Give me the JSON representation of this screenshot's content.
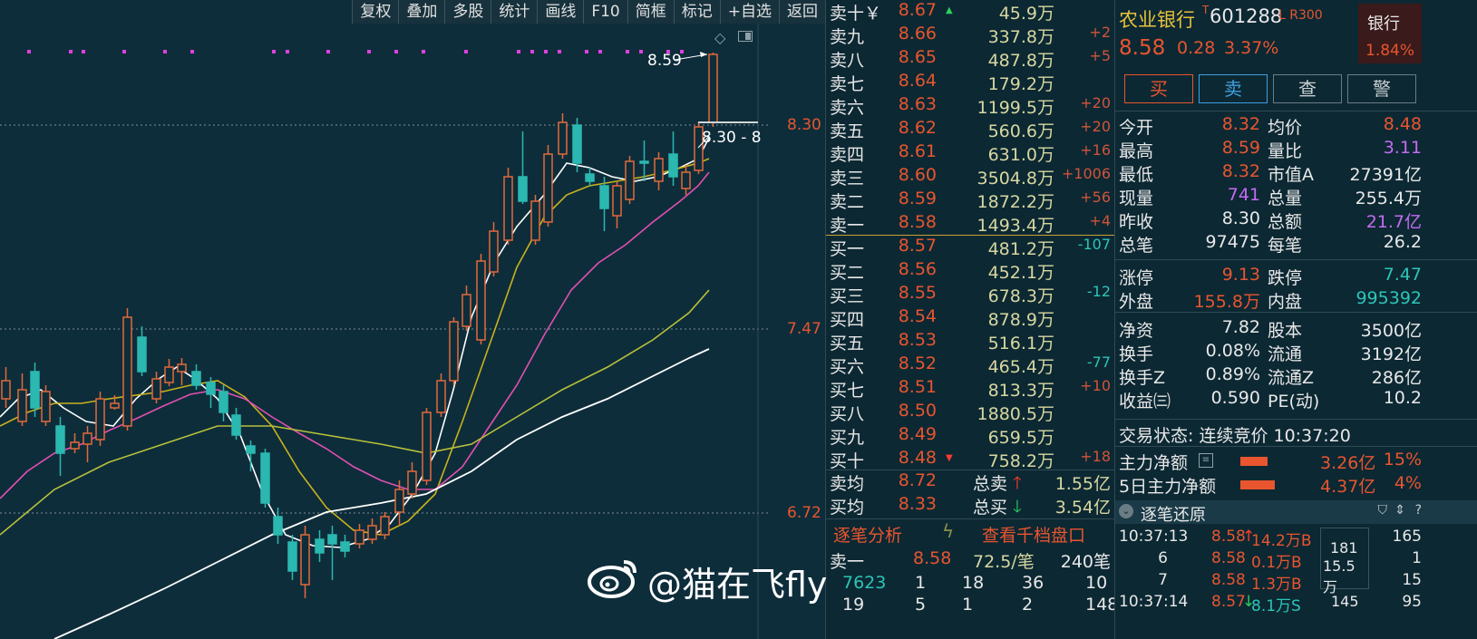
{
  "toolbar": {
    "items": [
      "复权",
      "叠加",
      "多股",
      "统计",
      "画线",
      "F10",
      "简框",
      "标记",
      "+自选",
      "返回"
    ]
  },
  "chart": {
    "price_labels": [
      "8.30",
      "7.47",
      "6.72"
    ],
    "high_marker": "8.59",
    "close_marker": "8.30 - 8",
    "watermark": "@猫在飞fly",
    "colors": {
      "up": "#e2693a",
      "down": "#2bb8b0",
      "ma5": "#ffffff",
      "ma10": "#c8b21e",
      "ma20": "#e050b0",
      "ma60": "#b9c23a",
      "ma120": "#ffffff",
      "grid": "#7d8e95",
      "marker": "#e040e0"
    }
  },
  "orderbook": {
    "asks": [
      {
        "label": "卖十￥",
        "price": "8.67",
        "vol": "45.9万",
        "chg": "",
        "arrow": "▲"
      },
      {
        "label": "卖九",
        "price": "8.66",
        "vol": "337.8万",
        "chg": "+2"
      },
      {
        "label": "卖八",
        "price": "8.65",
        "vol": "487.8万",
        "chg": "+5"
      },
      {
        "label": "卖七",
        "price": "8.64",
        "vol": "179.2万",
        "chg": ""
      },
      {
        "label": "卖六",
        "price": "8.63",
        "vol": "1199.5万",
        "chg": "+20"
      },
      {
        "label": "卖五",
        "price": "8.62",
        "vol": "560.6万",
        "chg": "+20"
      },
      {
        "label": "卖四",
        "price": "8.61",
        "vol": "631.0万",
        "chg": "+16"
      },
      {
        "label": "卖三",
        "price": "8.60",
        "vol": "3504.8万",
        "chg": "+1006"
      },
      {
        "label": "卖二",
        "price": "8.59",
        "vol": "1872.2万",
        "chg": "+56"
      },
      {
        "label": "卖一",
        "price": "8.58",
        "vol": "1493.4万",
        "chg": "+4"
      }
    ],
    "bids": [
      {
        "label": "买一",
        "price": "8.57",
        "vol": "481.2万",
        "chg": "-107"
      },
      {
        "label": "买二",
        "price": "8.56",
        "vol": "452.1万",
        "chg": ""
      },
      {
        "label": "买三",
        "price": "8.55",
        "vol": "678.3万",
        "chg": "-12"
      },
      {
        "label": "买四",
        "price": "8.54",
        "vol": "878.9万",
        "chg": ""
      },
      {
        "label": "买五",
        "price": "8.53",
        "vol": "516.1万",
        "chg": ""
      },
      {
        "label": "买六",
        "price": "8.52",
        "vol": "465.4万",
        "chg": "-77"
      },
      {
        "label": "买七",
        "price": "8.51",
        "vol": "813.3万",
        "chg": "+10"
      },
      {
        "label": "买八",
        "price": "8.50",
        "vol": "1880.5万",
        "chg": ""
      },
      {
        "label": "买九",
        "price": "8.49",
        "vol": "659.5万",
        "chg": ""
      },
      {
        "label": "买十",
        "price": "8.48",
        "vol": "758.2万",
        "chg": "+18",
        "arrow": "▼"
      }
    ],
    "summary": {
      "ask_avg_label": "卖均",
      "ask_avg": "8.72",
      "total_ask_label": "总卖",
      "total_ask": "1.55亿",
      "bid_avg_label": "买均",
      "bid_avg": "8.33",
      "total_bid_label": "总买",
      "total_bid": "3.54亿"
    },
    "tabs": {
      "left": "逐笔分析",
      "right": "查看千档盘口"
    },
    "ticker": {
      "label": "卖一",
      "price": "8.58",
      "per": "72.5/笔",
      "count": "240笔"
    },
    "queue": [
      [
        "7623",
        "1",
        "18",
        "36",
        "10"
      ],
      [
        "19",
        "5",
        "1",
        "2",
        "148"
      ]
    ]
  },
  "info": {
    "name": "农业银行",
    "code": "601288",
    "tags": "L R300",
    "sector": "银行",
    "sector_pct": "1.84%",
    "price": "8.58",
    "change": "0.28",
    "pct": "3.37%",
    "buttons": [
      "买",
      "卖",
      "查",
      "警"
    ],
    "rows": [
      [
        "今开",
        "8.32",
        "均价",
        "8.48"
      ],
      [
        "最高",
        "8.59",
        "量比",
        "3.11"
      ],
      [
        "最低",
        "8.32",
        "市值A",
        "27391亿"
      ],
      [
        "现量",
        "741",
        "总量",
        "255.4万"
      ],
      [
        "昨收",
        "8.30",
        "总额",
        "21.7亿"
      ],
      [
        "总笔",
        "97475",
        "每笔",
        "26.2"
      ],
      [
        "涨停",
        "9.13",
        "跌停",
        "7.47"
      ],
      [
        "外盘",
        "155.8万",
        "内盘",
        "995392"
      ],
      [
        "净资",
        "7.82",
        "股本",
        "3500亿"
      ],
      [
        "换手",
        "0.08%",
        "流通",
        "3192亿"
      ],
      [
        "换手Z",
        "0.89%",
        "流通Z",
        "286亿"
      ],
      [
        "收益㈢",
        "0.590",
        "PE(动)",
        "10.2"
      ]
    ],
    "status": "交易状态: 连续竞价 10:37:20",
    "flow": [
      {
        "label": "主力净额",
        "value": "3.26亿",
        "pct": "15%"
      },
      {
        "label": "5日主力净额",
        "value": "4.37亿",
        "pct": "4%"
      }
    ],
    "trades_title": "逐笔还原",
    "trades": [
      {
        "time": "10:37:13",
        "price": "8.58",
        "arrow": "↑",
        "vol": "14.2万B",
        "right": "165"
      },
      {
        "time": "6",
        "price": "8.58",
        "arrow": "",
        "vol": "0.1万B",
        "right": "1"
      },
      {
        "time": "7",
        "price": "8.58",
        "arrow": "",
        "vol": "1.3万B",
        "right": "15"
      },
      {
        "time": "10:37:14",
        "price": "8.57",
        "arrow": "↓",
        "vol": "8.1万S",
        "right": "95"
      }
    ],
    "trade_side": {
      "top": "181",
      "bottom": "15.5万",
      "lower": "145"
    }
  }
}
